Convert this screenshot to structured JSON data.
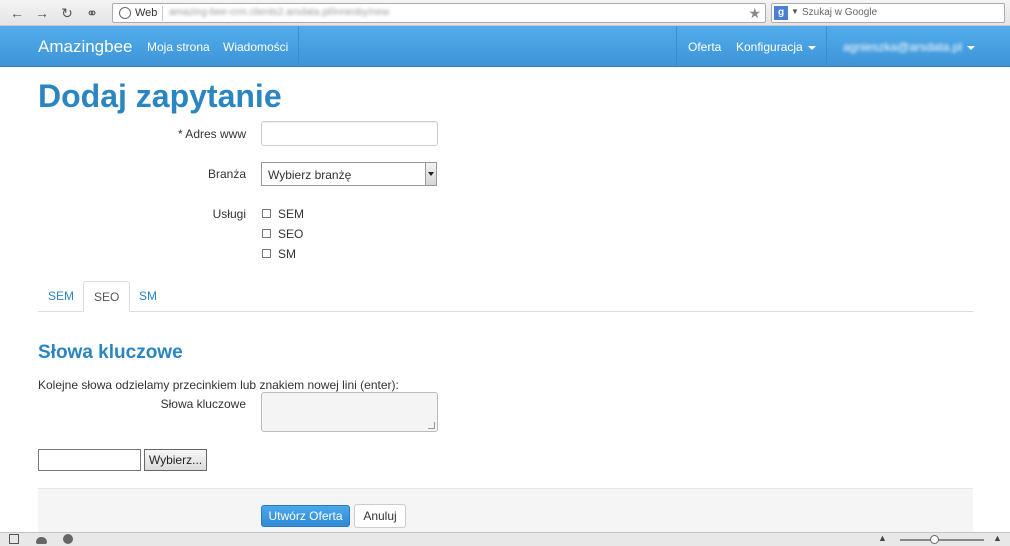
{
  "browser": {
    "site_label": "Web",
    "url": "amazing-bee-crm.clients2.arsdata.pl/inneoby/new",
    "search_placeholder": "Szukaj w Google"
  },
  "navbar": {
    "brand": "Amazingbee",
    "left_items": [
      "Moja strona",
      "Wiadomości"
    ],
    "oferta": "Oferta",
    "konfiguracja": "Konfiguracja",
    "user": "agnieszka@arsdata.pl"
  },
  "page": {
    "title": "Dodaj zapytanie"
  },
  "form": {
    "adres_label": "* Adres www",
    "adres_value": "",
    "branza_label": "Branża",
    "branza_selected": "Wybierz branżę",
    "uslugi_label": "Usługi",
    "uslugi_options": [
      "SEM",
      "SEO",
      "SM"
    ]
  },
  "tabs": [
    {
      "label": "SEM",
      "active": false
    },
    {
      "label": "SEO",
      "active": true
    },
    {
      "label": "SM",
      "active": false
    }
  ],
  "keywords": {
    "heading": "Słowa kluczowe",
    "hint": "Kolejne słowa odzielamy przecinkiem lub znakiem nowej lini (enter):",
    "label": "Słowa kluczowe",
    "value": ""
  },
  "file": {
    "button_label": "Wybierz..."
  },
  "actions": {
    "submit_label": "Utwórz Oferta",
    "cancel_label": "Anuluj"
  },
  "colors": {
    "accent": "#2a85c0",
    "navbar": "#3d95d8"
  }
}
